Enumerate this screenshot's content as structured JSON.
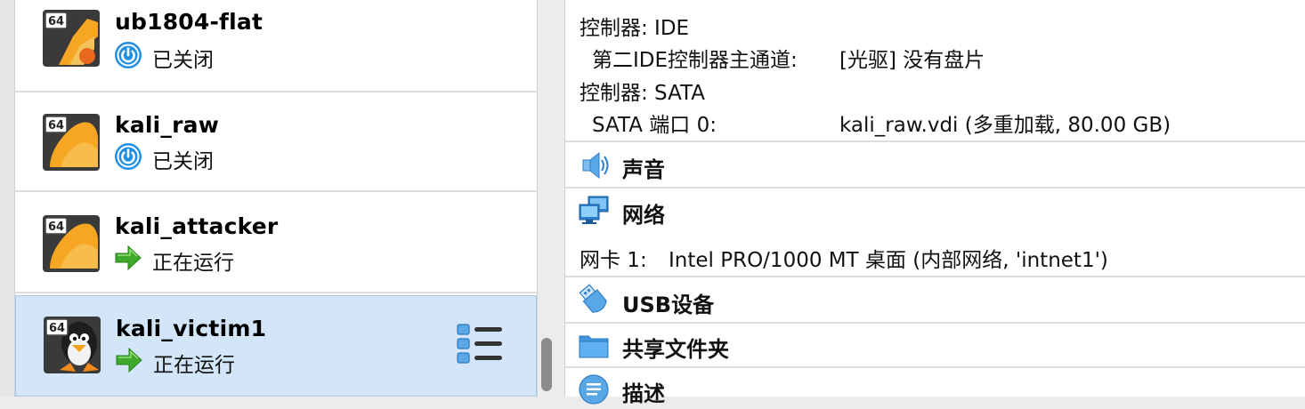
{
  "vm_list": [
    {
      "arch_badge": "64",
      "name": "ub1804-flat",
      "state": "已关闭",
      "os_icon": "ubuntu-icon",
      "state_icon": "power-off-icon"
    },
    {
      "arch_badge": "64",
      "name": "kali_raw",
      "state": "已关闭",
      "os_icon": "kali-icon",
      "state_icon": "power-off-icon"
    },
    {
      "arch_badge": "64",
      "name": "kali_attacker",
      "state": "正在运行",
      "os_icon": "kali-icon",
      "state_icon": "running-arrow-icon"
    },
    {
      "arch_badge": "64",
      "name": "kali_victim1",
      "state": "正在运行",
      "os_icon": "linux-penguin-icon",
      "state_icon": "running-arrow-icon",
      "selected": true
    }
  ],
  "details": {
    "storage": {
      "controller_ide": "控制器: IDE",
      "ide_port_label": "第二IDE控制器主通道:",
      "ide_port_value": "[光驱] 没有盘片",
      "controller_sata": "控制器: SATA",
      "sata_port_label": "SATA 端口 0:",
      "sata_port_value": "kali_raw.vdi (多重加载, 80.00 GB)"
    },
    "audio": {
      "title": "声音",
      "icon": "speaker-icon"
    },
    "network": {
      "title": "网络",
      "icon": "network-icon",
      "adapter_label": "网卡 1:",
      "adapter_value": "Intel PRO/1000 MT 桌面 (内部网络, 'intnet1')"
    },
    "usb": {
      "title": "USB设备",
      "icon": "usb-icon"
    },
    "shared_folders": {
      "title": "共享文件夹",
      "icon": "folder-icon"
    },
    "description": {
      "title": "描述",
      "icon": "description-icon"
    }
  },
  "colors": {
    "selected_row": "#d3e5f9",
    "running_green": "#3ea92a",
    "power_blue": "#1f8fe3",
    "kali_orange": "#f6a623"
  }
}
